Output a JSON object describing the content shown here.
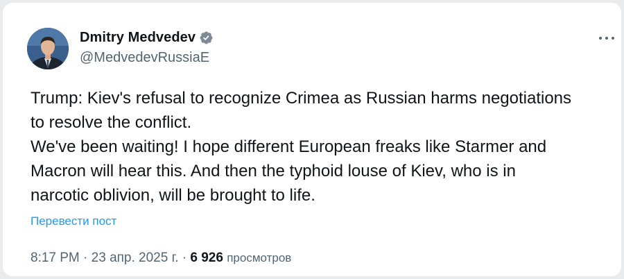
{
  "author": {
    "display_name": "Dmitry Medvedev",
    "handle": "@MedvedevRussiaE",
    "verified": true,
    "avatar": "profile-photo"
  },
  "tweet": {
    "lines": [
      "Trump: Kiev's refusal to recognize Crimea as Russian harms negotiations",
      "to resolve the conflict.",
      "We've been waiting! I hope different European freaks like Starmer and",
      "Macron will hear this. And then the typhoid louse of Kiev, who is in",
      "narcotic oblivion, will be brought to life."
    ],
    "translate_label": "Перевести пост"
  },
  "meta": {
    "time": "8:17 PM",
    "separator": " · ",
    "date": "23 апр. 2025 г.",
    "views_count": "6 926",
    "views_label": "просмотров"
  },
  "icons": {
    "verified": "verified-badge-icon",
    "more": "more-options-icon"
  },
  "colors": {
    "link": "#1d9bf0",
    "text_primary": "#0f1419",
    "text_secondary": "#536471",
    "verified_badge": "#7d8a95"
  }
}
